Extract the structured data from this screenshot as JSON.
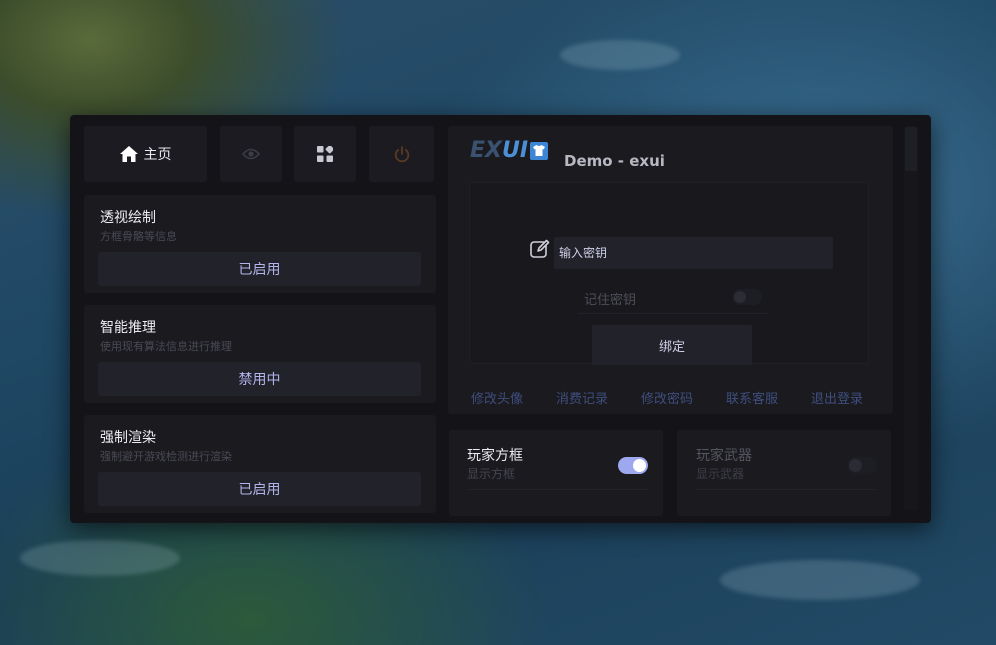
{
  "nav": {
    "home_label": "主页",
    "eye_icon": "eye-icon",
    "grid_icon": "apps-grid-icon",
    "power_icon": "power-icon"
  },
  "cards": [
    {
      "title": "透视绘制",
      "desc": "方框骨骼等信息",
      "button": "已启用"
    },
    {
      "title": "智能推理",
      "desc": "使用现有算法信息进行推理",
      "button": "禁用中"
    },
    {
      "title": "强制渲染",
      "desc": "强制避开游戏检测进行渲染",
      "button": "已启用"
    }
  ],
  "header": {
    "logo_prefix": "EX",
    "logo_suffix": "UI",
    "title": "Demo - exui"
  },
  "login": {
    "key_input_value": "输入密钥",
    "remember_label": "记住密钥",
    "remember_on": false,
    "bind_label": "绑定"
  },
  "links": [
    "修改头像",
    "消费记录",
    "修改密码",
    "联系客服",
    "退出登录"
  ],
  "features": [
    {
      "title": "玩家方框",
      "desc": "显示方框",
      "enabled": true
    },
    {
      "title": "玩家武器",
      "desc": "显示武器",
      "enabled": false
    }
  ],
  "colors": {
    "accent": "#9ea8ee",
    "button_text": "#b4b4ec",
    "link": "#3f4e7e",
    "logo_blue": "#4b8fd6"
  }
}
